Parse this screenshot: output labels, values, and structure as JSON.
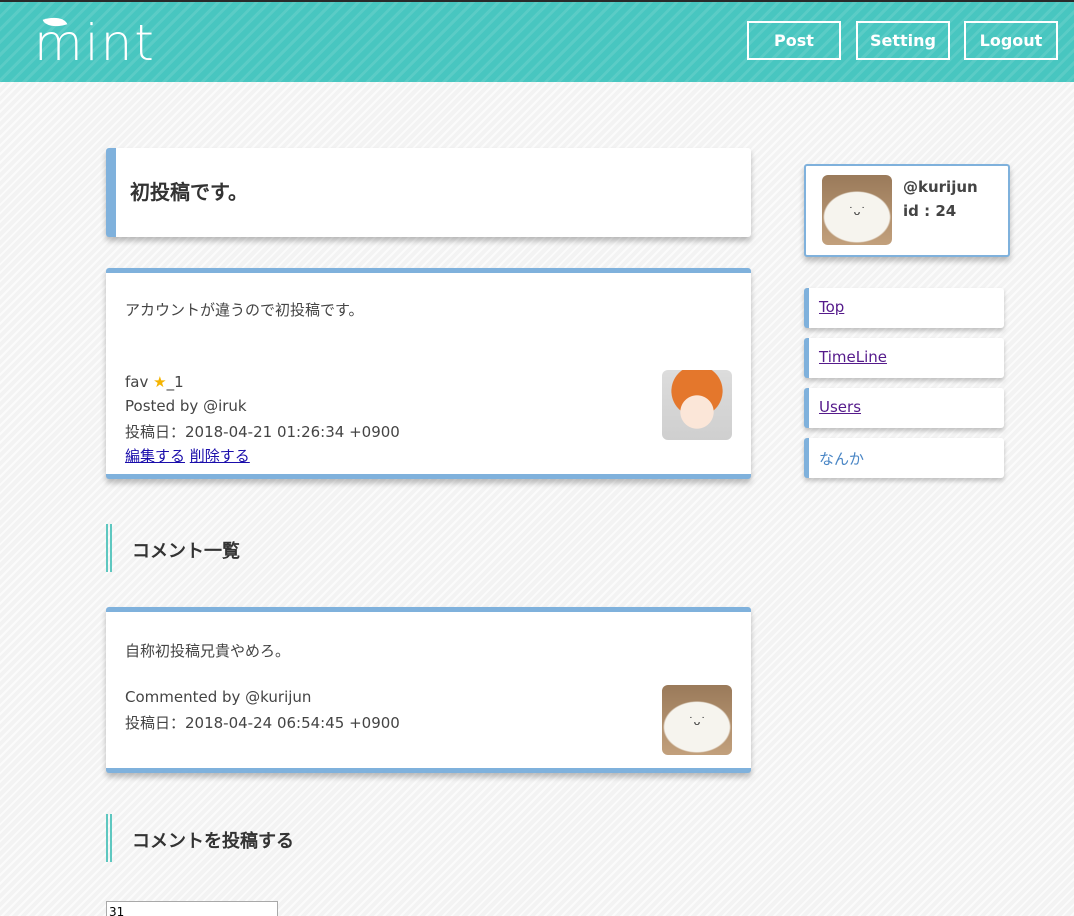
{
  "header": {
    "logo_text": "mint",
    "buttons": {
      "post": "Post",
      "setting": "Setting",
      "logout": "Logout"
    }
  },
  "post": {
    "title": "初投稿です。",
    "body": "アカウントが違うので初投稿です。",
    "fav_label": "fav",
    "fav_count": "_1",
    "posted_by": "Posted by @iruk",
    "date": "投稿日：2018-04-21 01:26:34 +0900",
    "edit_link": "編集する",
    "delete_link": "削除する"
  },
  "sections": {
    "comments_title": "コメント一覧",
    "post_comment_title": "コメントを投稿する"
  },
  "comments": [
    {
      "body": "自称初投稿兄貴やめろ。",
      "by": "Commented by @kurijun",
      "date": "投稿日：2018-04-24 06:54:45 +0900"
    }
  ],
  "profile": {
    "name": "@kurijun",
    "id": "id : 24"
  },
  "nav": [
    {
      "label": "Top"
    },
    {
      "label": "TimeLine"
    },
    {
      "label": "Users"
    },
    {
      "label": "なんか"
    }
  ],
  "comment_form": {
    "value": "31"
  },
  "colors": {
    "header": "#48c6c0",
    "accent": "#7fb1dc",
    "section_bar": "#5ec7c0"
  }
}
